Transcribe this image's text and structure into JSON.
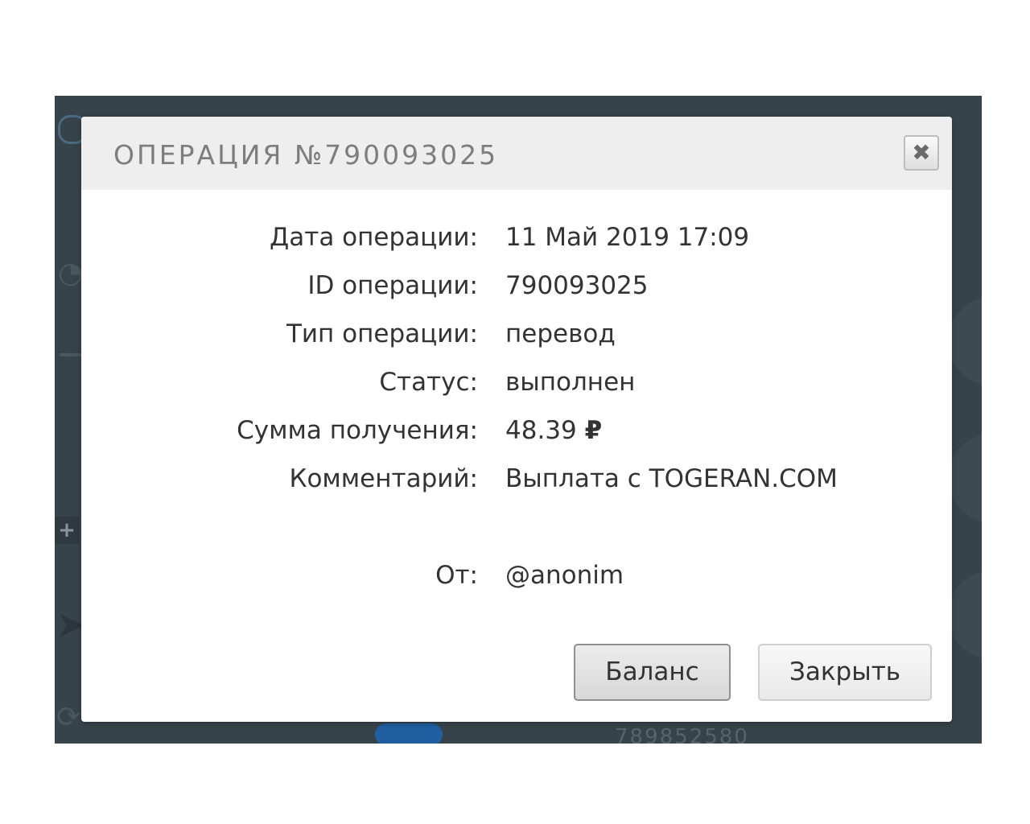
{
  "modal": {
    "title": "ОПЕРАЦИЯ №790093025",
    "close_icon": "close-icon"
  },
  "details": [
    {
      "label": "Дата операции:",
      "value": "11 Май 2019 17:09"
    },
    {
      "label": "ID операции:",
      "value": "790093025"
    },
    {
      "label": "Тип операции:",
      "value": "перевод"
    },
    {
      "label": "Статус:",
      "value": "выполнен"
    },
    {
      "label": "Сумма получения:",
      "value": "48.39",
      "currency": "₽"
    },
    {
      "label": "Комментарий:",
      "value": "Выплата с TOGERAN.COM"
    },
    {
      "label": "От:",
      "value": "@anonim"
    }
  ],
  "buttons": {
    "balance": "Баланс",
    "close": "Закрыть"
  },
  "background": {
    "number_partial": "789852580"
  },
  "colors": {
    "backdrop": "#37434a",
    "header_bg": "#eeeeee",
    "title_text": "#7d7d7d",
    "body_text": "#333333"
  }
}
